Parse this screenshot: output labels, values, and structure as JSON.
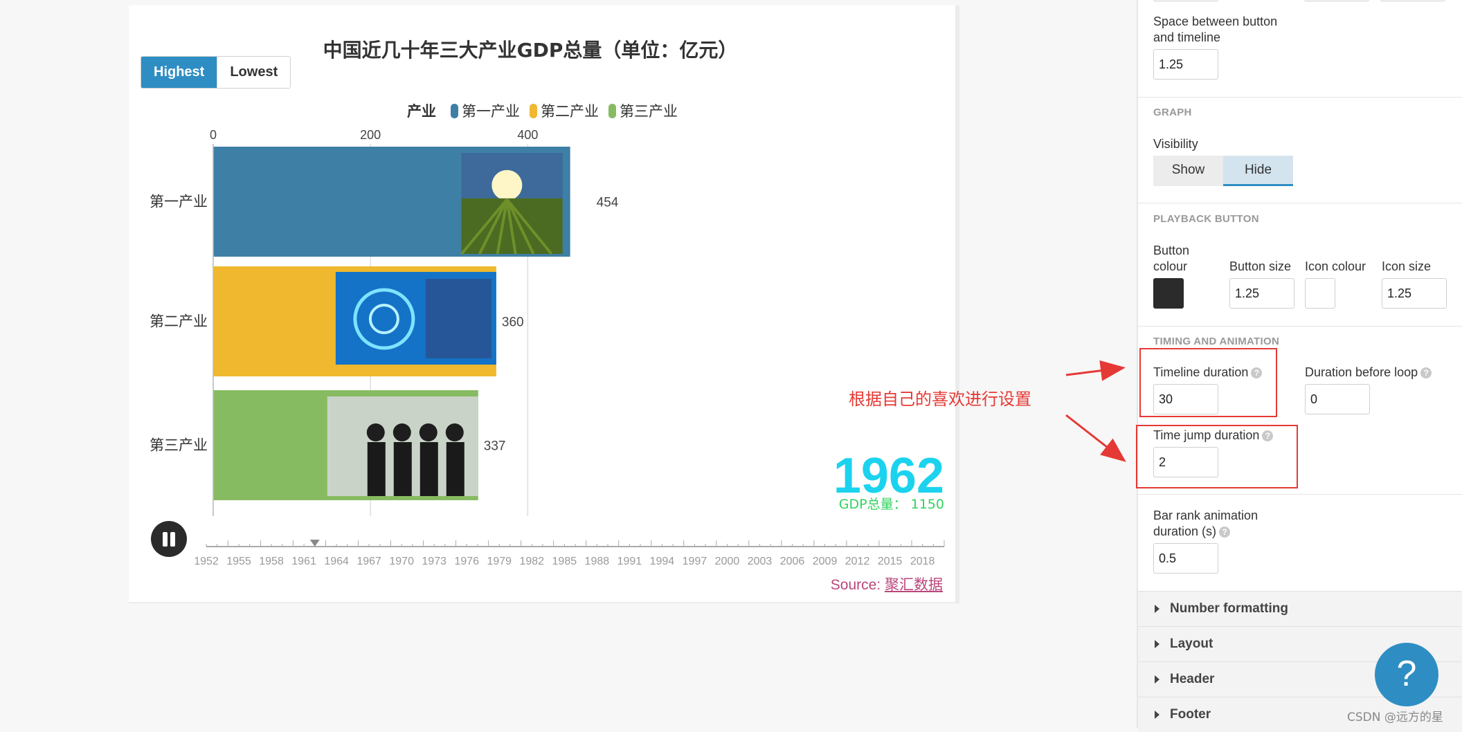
{
  "chart": {
    "title": "中国近几十年三大产业GDP总量（单位：亿元）",
    "filter_buttons": {
      "highest": "Highest",
      "lowest": "Lowest"
    },
    "legend_title": "产业",
    "current_year": "1962",
    "total_text": "GDP总量： 1150",
    "source_prefix": "Source: ",
    "source_link": "聚汇数据",
    "timeline_years": [
      "1952",
      "1955",
      "1958",
      "1961",
      "1964",
      "1967",
      "1970",
      "1973",
      "1976",
      "1979",
      "1982",
      "1985",
      "1988",
      "1991",
      "1994",
      "1997",
      "2000",
      "2003",
      "2006",
      "2009",
      "2012",
      "2015",
      "2018"
    ]
  },
  "chart_data": {
    "type": "bar",
    "orientation": "horizontal",
    "title": "中国近几十年三大产业GDP总量（单位：亿元）",
    "categories": [
      "第一产业",
      "第二产业",
      "第三产业"
    ],
    "values": [
      454,
      360,
      337
    ],
    "series": [
      {
        "name": "第一产业",
        "value": 454,
        "color": "#3e7fa6"
      },
      {
        "name": "第二产业",
        "value": 360,
        "color": "#efb82e"
      },
      {
        "name": "第三产业",
        "value": 337,
        "color": "#87bb62"
      }
    ],
    "xlim": [
      0,
      530
    ],
    "xticks": [
      0,
      200,
      400
    ],
    "grid": true,
    "legend": "top-center",
    "year": 1962,
    "colors": {
      "year": "#1bd3ee",
      "total": "#2fd35f"
    }
  },
  "annotation": {
    "text": "根据自己的喜欢进行设置"
  },
  "panel": {
    "space_label": "Space between button and timeline",
    "space_value": "1.25",
    "graph_heading": "GRAPH",
    "visibility_label": "Visibility",
    "show_label": "Show",
    "hide_label": "Hide",
    "playback_heading": "PLAYBACK BUTTON",
    "button_colour_label": "Button colour",
    "button_size_label": "Button size",
    "button_size_value": "1.25",
    "icon_colour_label": "Icon colour",
    "icon_size_label": "Icon size",
    "icon_size_value": "1.25",
    "timing_heading": "TIMING AND ANIMATION",
    "timeline_duration_label": "Timeline duration",
    "timeline_duration_value": "30",
    "duration_before_loop_label": "Duration before loop",
    "duration_before_loop_value": "0",
    "time_jump_label": "Time jump duration",
    "time_jump_value": "2",
    "bar_rank_label": "Bar rank animation duration (s)",
    "bar_rank_value": "0.5",
    "accordions": [
      "Number formatting",
      "Layout",
      "Header",
      "Footer"
    ],
    "colors": {
      "button_colour": "#2b2b2b",
      "icon_colour": "#ffffff"
    }
  },
  "watermark": "CSDN @远方的星"
}
